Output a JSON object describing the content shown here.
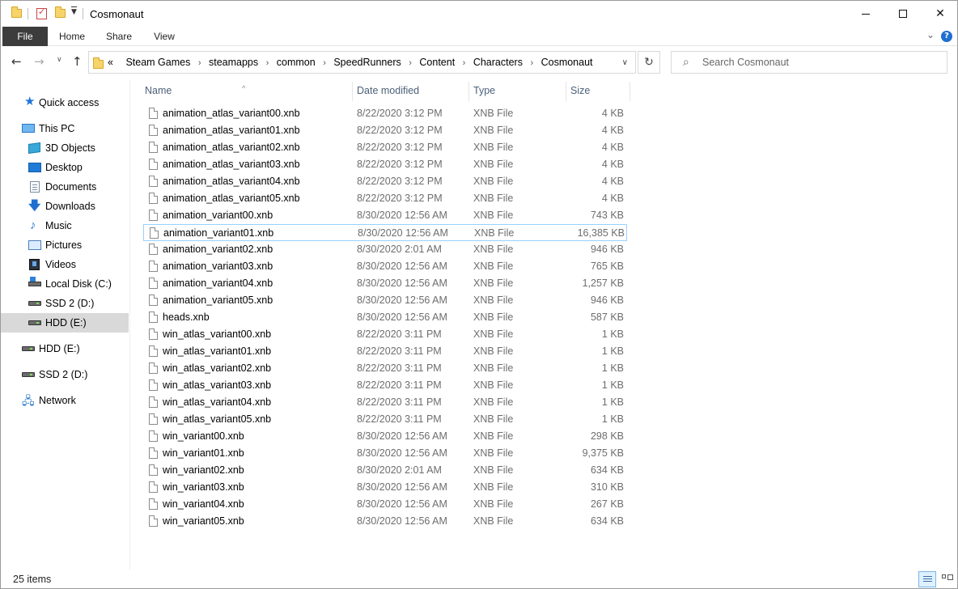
{
  "window": {
    "title": "Cosmonaut"
  },
  "ribbon": {
    "tabs": [
      "File",
      "Home",
      "Share",
      "View"
    ]
  },
  "address": {
    "overflow": "«",
    "crumbs": [
      "Steam Games",
      "steamapps",
      "common",
      "SpeedRunners",
      "Content",
      "Characters",
      "Cosmonaut"
    ]
  },
  "search": {
    "placeholder": "Search Cosmonaut"
  },
  "navpane": {
    "quick_access": "Quick access",
    "this_pc": "This PC",
    "items": [
      {
        "label": "3D Objects",
        "icon": "cube-icon"
      },
      {
        "label": "Desktop",
        "icon": "desktop-icon"
      },
      {
        "label": "Documents",
        "icon": "documents-icon"
      },
      {
        "label": "Downloads",
        "icon": "download-arrow-icon"
      },
      {
        "label": "Music",
        "icon": "music-note-icon"
      },
      {
        "label": "Pictures",
        "icon": "pictures-icon"
      },
      {
        "label": "Videos",
        "icon": "video-film-icon"
      },
      {
        "label": "Local Disk (C:)",
        "icon": "local-disk-icon"
      },
      {
        "label": "SSD 2 (D:)",
        "icon": "drive-icon"
      },
      {
        "label": "HDD (E:)",
        "icon": "drive-icon",
        "selected": true
      }
    ],
    "drives": [
      {
        "label": "HDD (E:)"
      },
      {
        "label": "SSD 2 (D:)"
      }
    ],
    "network": "Network"
  },
  "columns": {
    "name": "Name",
    "date": "Date modified",
    "type": "Type",
    "size": "Size"
  },
  "files": [
    {
      "name": "animation_atlas_variant00.xnb",
      "date": "8/22/2020 3:12 PM",
      "type": "XNB File",
      "size": "4 KB"
    },
    {
      "name": "animation_atlas_variant01.xnb",
      "date": "8/22/2020 3:12 PM",
      "type": "XNB File",
      "size": "4 KB"
    },
    {
      "name": "animation_atlas_variant02.xnb",
      "date": "8/22/2020 3:12 PM",
      "type": "XNB File",
      "size": "4 KB"
    },
    {
      "name": "animation_atlas_variant03.xnb",
      "date": "8/22/2020 3:12 PM",
      "type": "XNB File",
      "size": "4 KB"
    },
    {
      "name": "animation_atlas_variant04.xnb",
      "date": "8/22/2020 3:12 PM",
      "type": "XNB File",
      "size": "4 KB"
    },
    {
      "name": "animation_atlas_variant05.xnb",
      "date": "8/22/2020 3:12 PM",
      "type": "XNB File",
      "size": "4 KB"
    },
    {
      "name": "animation_variant00.xnb",
      "date": "8/30/2020 12:56 AM",
      "type": "XNB File",
      "size": "743 KB"
    },
    {
      "name": "animation_variant01.xnb",
      "date": "8/30/2020 12:56 AM",
      "type": "XNB File",
      "size": "16,385 KB",
      "focused": true
    },
    {
      "name": "animation_variant02.xnb",
      "date": "8/30/2020 2:01 AM",
      "type": "XNB File",
      "size": "946 KB"
    },
    {
      "name": "animation_variant03.xnb",
      "date": "8/30/2020 12:56 AM",
      "type": "XNB File",
      "size": "765 KB"
    },
    {
      "name": "animation_variant04.xnb",
      "date": "8/30/2020 12:56 AM",
      "type": "XNB File",
      "size": "1,257 KB"
    },
    {
      "name": "animation_variant05.xnb",
      "date": "8/30/2020 12:56 AM",
      "type": "XNB File",
      "size": "946 KB"
    },
    {
      "name": "heads.xnb",
      "date": "8/30/2020 12:56 AM",
      "type": "XNB File",
      "size": "587 KB"
    },
    {
      "name": "win_atlas_variant00.xnb",
      "date": "8/22/2020 3:11 PM",
      "type": "XNB File",
      "size": "1 KB"
    },
    {
      "name": "win_atlas_variant01.xnb",
      "date": "8/22/2020 3:11 PM",
      "type": "XNB File",
      "size": "1 KB"
    },
    {
      "name": "win_atlas_variant02.xnb",
      "date": "8/22/2020 3:11 PM",
      "type": "XNB File",
      "size": "1 KB"
    },
    {
      "name": "win_atlas_variant03.xnb",
      "date": "8/22/2020 3:11 PM",
      "type": "XNB File",
      "size": "1 KB"
    },
    {
      "name": "win_atlas_variant04.xnb",
      "date": "8/22/2020 3:11 PM",
      "type": "XNB File",
      "size": "1 KB"
    },
    {
      "name": "win_atlas_variant05.xnb",
      "date": "8/22/2020 3:11 PM",
      "type": "XNB File",
      "size": "1 KB"
    },
    {
      "name": "win_variant00.xnb",
      "date": "8/30/2020 12:56 AM",
      "type": "XNB File",
      "size": "298 KB"
    },
    {
      "name": "win_variant01.xnb",
      "date": "8/30/2020 12:56 AM",
      "type": "XNB File",
      "size": "9,375 KB"
    },
    {
      "name": "win_variant02.xnb",
      "date": "8/30/2020 2:01 AM",
      "type": "XNB File",
      "size": "634 KB"
    },
    {
      "name": "win_variant03.xnb",
      "date": "8/30/2020 12:56 AM",
      "type": "XNB File",
      "size": "310 KB"
    },
    {
      "name": "win_variant04.xnb",
      "date": "8/30/2020 12:56 AM",
      "type": "XNB File",
      "size": "267 KB"
    },
    {
      "name": "win_variant05.xnb",
      "date": "8/30/2020 12:56 AM",
      "type": "XNB File",
      "size": "634 KB"
    }
  ],
  "status": {
    "count": "25 items"
  },
  "colors": {
    "file_tab": "#3c3c3c",
    "selected_nav": "#d9d9d9",
    "focus_border": "#99d1ff",
    "header_text": "#4c607a"
  }
}
